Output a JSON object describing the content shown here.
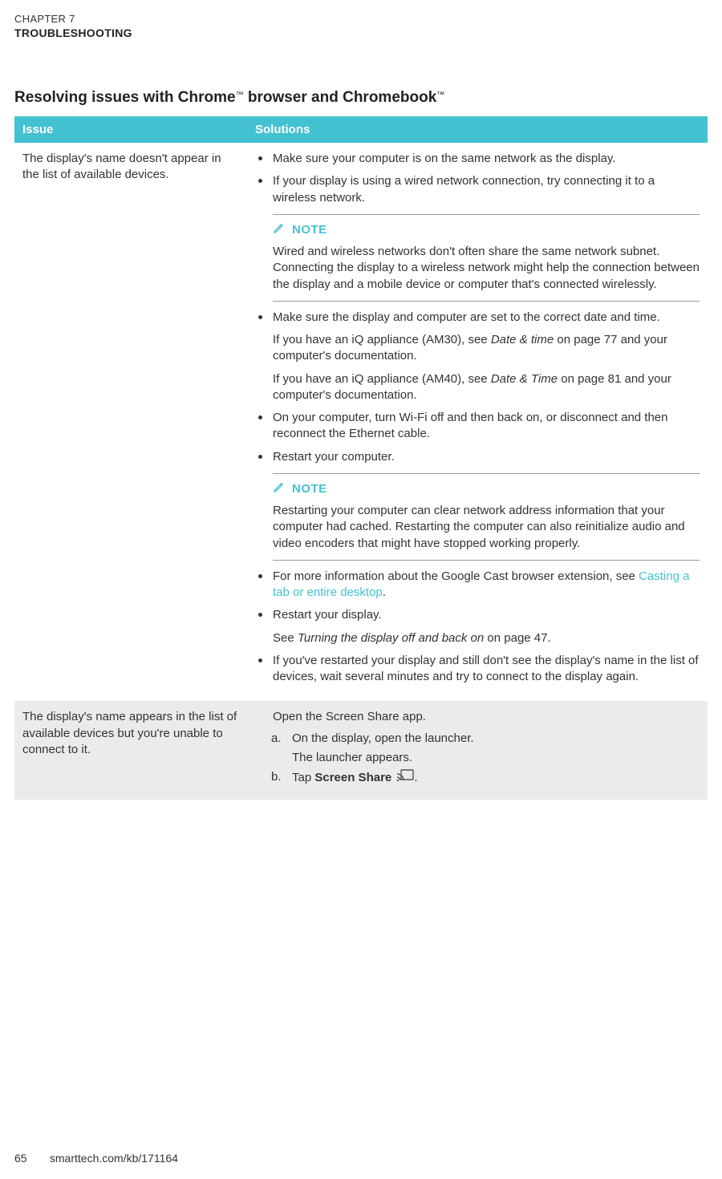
{
  "header": {
    "chapter_label": "CHAPTER 7",
    "chapter_title": "TROUBLESHOOTING"
  },
  "section": {
    "title_pre": "Resolving issues with Chrome",
    "title_mid": " browser and Chromebook",
    "tm": "™"
  },
  "table": {
    "head_issue": "Issue",
    "head_solutions": "Solutions",
    "row1": {
      "issue": "The display's name doesn't appear in the list of available devices.",
      "s1": "Make sure your computer is on the same network as the display.",
      "s2": "If your display is using a wired network connection, try connecting it to a wireless network.",
      "note1_label": "NOTE",
      "note1_body": "Wired and wireless networks don't often share the same network subnet. Connecting the display to a wireless network might help the connection between the display and a mobile device or computer that's connected wirelessly.",
      "s3": "Make sure the display and computer are set to the correct date and time.",
      "s3_p1a": "If you have an iQ appliance (AM30), see ",
      "s3_p1i": "Date & time",
      "s3_p1b": " on page 77 and your computer's documentation.",
      "s3_p2a": "If you have an iQ appliance (AM40), see ",
      "s3_p2i": "Date & Time",
      "s3_p2b": " on page 81 and your computer's documentation.",
      "s4": "On your computer, turn Wi-Fi off and then back on, or disconnect and then reconnect the Ethernet cable.",
      "s5": "Restart your computer.",
      "note2_label": "NOTE",
      "note2_body": "Restarting your computer can clear network address information that your computer had cached. Restarting the computer can also reinitialize audio and video encoders that might have stopped working properly.",
      "s6a": "For more information about the Google Cast browser extension, see ",
      "s6_link": "Casting a tab or entire desktop",
      "s6b": ".",
      "s7": "Restart your display.",
      "s7_p1a": "See ",
      "s7_p1i": "Turning the display off and back on",
      "s7_p1b": " on page 47.",
      "s8": "If you've restarted your display and still don't see the display's name in the list of devices, wait several minutes and try to connect to the display again."
    },
    "row2": {
      "issue": "The display's name appears in the list of available devices but you're unable to connect to it.",
      "intro": "Open the Screen Share app.",
      "a_marker": "a.",
      "a_text": "On the display, open the launcher.",
      "a_sub": "The launcher appears.",
      "b_marker": "b.",
      "b_pre": "Tap ",
      "b_bold": "Screen Share",
      "b_post": "."
    }
  },
  "footer": {
    "page_number": "65",
    "url": "smarttech.com/kb/171164"
  }
}
